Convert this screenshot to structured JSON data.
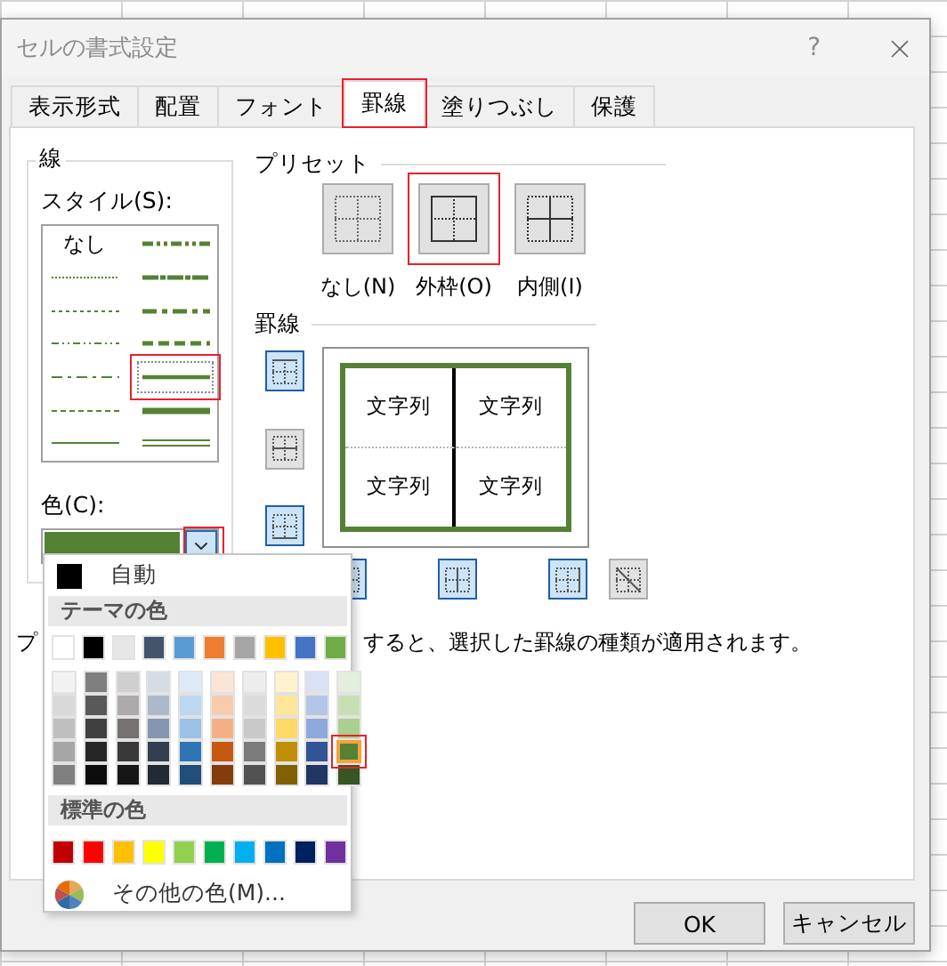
{
  "window": {
    "title": "セルの書式設定",
    "help": "?"
  },
  "tabs": [
    {
      "label": "表示形式",
      "selected": false
    },
    {
      "label": "配置",
      "selected": false
    },
    {
      "label": "フォント",
      "selected": false
    },
    {
      "label": "罫線",
      "selected": true
    },
    {
      "label": "塗りつぶし",
      "selected": false
    },
    {
      "label": "保護",
      "selected": false
    }
  ],
  "line_group": {
    "title": "線",
    "style_label": "スタイル(S):",
    "styles": [
      {
        "kind": "none",
        "label": "なし",
        "selected": false
      },
      {
        "kind": "medium-dash-dot-dot",
        "selected": false
      },
      {
        "kind": "hair",
        "selected": false
      },
      {
        "kind": "slant-dash-dot",
        "selected": false
      },
      {
        "kind": "dotted",
        "selected": false
      },
      {
        "kind": "medium-dash-dot",
        "selected": false
      },
      {
        "kind": "dash-dot-dot",
        "selected": false
      },
      {
        "kind": "medium-dashed",
        "selected": false
      },
      {
        "kind": "dash-dot",
        "selected": false
      },
      {
        "kind": "medium",
        "selected": true
      },
      {
        "kind": "dashed",
        "selected": false
      },
      {
        "kind": "thick",
        "selected": false
      },
      {
        "kind": "thin",
        "selected": false
      },
      {
        "kind": "double",
        "selected": false
      }
    ],
    "color_label": "色(C):",
    "color": "#548235",
    "dropdown_highlighted": true
  },
  "presets": {
    "title": "プリセット",
    "items": [
      {
        "kind": "none",
        "label": "なし(N)",
        "highlighted": false
      },
      {
        "kind": "outline",
        "label": "外枠(O)",
        "highlighted": true
      },
      {
        "kind": "inside",
        "label": "内側(I)",
        "highlighted": false
      }
    ]
  },
  "border": {
    "title": "罫線",
    "side_buttons": [
      {
        "kind": "top",
        "pressed": true,
        "color": "#548235"
      },
      {
        "kind": "middle",
        "pressed": false
      },
      {
        "kind": "bottom",
        "pressed": true,
        "color": "#548235"
      }
    ],
    "bottom_buttons": [
      {
        "kind": "left",
        "pressed": true,
        "color": "#548235"
      },
      {
        "kind": "center",
        "pressed": true,
        "color": "#000000"
      },
      {
        "kind": "right",
        "pressed": true,
        "color": "#548235"
      },
      {
        "kind": "diagonal",
        "pressed": false
      }
    ],
    "preview_cells": [
      "文字列",
      "文字列",
      "文字列",
      "文字列"
    ]
  },
  "note": [
    "プ",
    "すると、選択した罫線の種類が適用されます。"
  ],
  "color_menu": {
    "automatic": "自動",
    "theme_title": "テーマの色",
    "theme_colors": [
      {
        "color": "#ffffff",
        "selected": false,
        "shades": [
          {
            "color": "#f2f2f2",
            "selected": false
          },
          {
            "color": "#d9d9d9",
            "selected": false
          },
          {
            "color": "#bfbfbf",
            "selected": false
          },
          {
            "color": "#a6a6a6",
            "selected": false
          },
          {
            "color": "#808080",
            "selected": false
          }
        ]
      },
      {
        "color": "#000000",
        "selected": false,
        "shades": [
          {
            "color": "#7f7f7f",
            "selected": false
          },
          {
            "color": "#595959",
            "selected": false
          },
          {
            "color": "#404040",
            "selected": false
          },
          {
            "color": "#262626",
            "selected": false
          },
          {
            "color": "#0d0d0d",
            "selected": false
          }
        ]
      },
      {
        "color": "#e7e6e6",
        "selected": false,
        "shades": [
          {
            "color": "#d0cece",
            "selected": false
          },
          {
            "color": "#aeaaaa",
            "selected": false
          },
          {
            "color": "#757171",
            "selected": false
          },
          {
            "color": "#3a3838",
            "selected": false
          },
          {
            "color": "#171616",
            "selected": false
          }
        ]
      },
      {
        "color": "#44546a",
        "selected": false,
        "shades": [
          {
            "color": "#d6dce4",
            "selected": false
          },
          {
            "color": "#adb9ca",
            "selected": false
          },
          {
            "color": "#8497b0",
            "selected": false
          },
          {
            "color": "#333f4f",
            "selected": false
          },
          {
            "color": "#222b35",
            "selected": false
          }
        ]
      },
      {
        "color": "#5b9bd5",
        "selected": false,
        "shades": [
          {
            "color": "#ddebf7",
            "selected": false
          },
          {
            "color": "#bdd7ee",
            "selected": false
          },
          {
            "color": "#9bc2e6",
            "selected": false
          },
          {
            "color": "#2f75b5",
            "selected": false
          },
          {
            "color": "#1f4e78",
            "selected": false
          }
        ]
      },
      {
        "color": "#ed7d31",
        "selected": false,
        "shades": [
          {
            "color": "#fce4d6",
            "selected": false
          },
          {
            "color": "#f8cbad",
            "selected": false
          },
          {
            "color": "#f4b084",
            "selected": false
          },
          {
            "color": "#c65911",
            "selected": false
          },
          {
            "color": "#833c0c",
            "selected": false
          }
        ]
      },
      {
        "color": "#a5a5a5",
        "selected": false,
        "shades": [
          {
            "color": "#ededed",
            "selected": false
          },
          {
            "color": "#dbdbdb",
            "selected": false
          },
          {
            "color": "#c9c9c9",
            "selected": false
          },
          {
            "color": "#7b7b7b",
            "selected": false
          },
          {
            "color": "#525252",
            "selected": false
          }
        ]
      },
      {
        "color": "#ffc000",
        "selected": false,
        "shades": [
          {
            "color": "#fff2cc",
            "selected": false
          },
          {
            "color": "#ffe699",
            "selected": false
          },
          {
            "color": "#ffd966",
            "selected": false
          },
          {
            "color": "#bf8f00",
            "selected": false
          },
          {
            "color": "#806000",
            "selected": false
          }
        ]
      },
      {
        "color": "#4472c4",
        "selected": false,
        "shades": [
          {
            "color": "#d9e1f2",
            "selected": false
          },
          {
            "color": "#b4c6e7",
            "selected": false
          },
          {
            "color": "#8ea9db",
            "selected": false
          },
          {
            "color": "#305496",
            "selected": false
          },
          {
            "color": "#203764",
            "selected": false
          }
        ]
      },
      {
        "color": "#70ad47",
        "selected": false,
        "shades": [
          {
            "color": "#e2efda",
            "selected": false
          },
          {
            "color": "#c6e0b4",
            "selected": false
          },
          {
            "color": "#a9d08e",
            "selected": false
          },
          {
            "color": "#548235",
            "selected": true
          },
          {
            "color": "#375623",
            "selected": false
          }
        ]
      }
    ],
    "standard_title": "標準の色",
    "standard_colors": [
      {
        "color": "#c00000",
        "selected": false
      },
      {
        "color": "#ff0000",
        "selected": false
      },
      {
        "color": "#ffc000",
        "selected": false
      },
      {
        "color": "#ffff00",
        "selected": false
      },
      {
        "color": "#92d050",
        "selected": false
      },
      {
        "color": "#00b050",
        "selected": false
      },
      {
        "color": "#00b0f0",
        "selected": false
      },
      {
        "color": "#0070c0",
        "selected": false
      },
      {
        "color": "#002060",
        "selected": false
      },
      {
        "color": "#7030a0",
        "selected": false
      }
    ],
    "more": "その他の色(M)..."
  },
  "buttons": [
    {
      "label": "OK"
    },
    {
      "label": "キャンセル"
    }
  ]
}
